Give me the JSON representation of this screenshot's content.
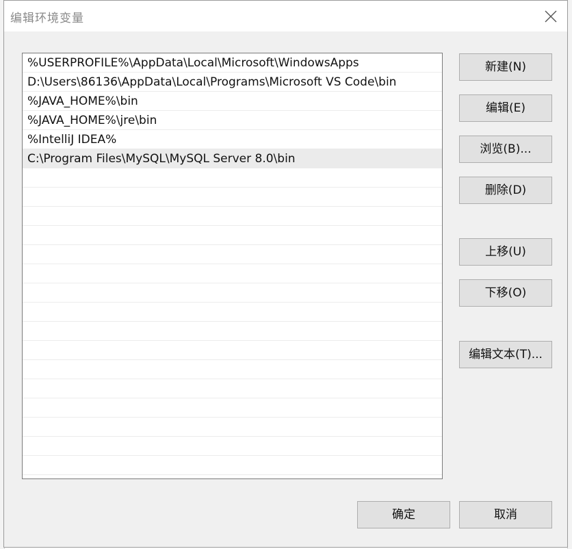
{
  "dialog": {
    "title": "编辑环境变量"
  },
  "icons": {
    "close": "close-icon"
  },
  "path_list": [
    "%USERPROFILE%\\AppData\\Local\\Microsoft\\WindowsApps",
    "D:\\Users\\86136\\AppData\\Local\\Programs\\Microsoft VS Code\\bin",
    "%JAVA_HOME%\\bin",
    "%JAVA_HOME%\\jre\\bin",
    "%IntelliJ IDEA%",
    "C:\\Program Files\\MySQL\\MySQL Server 8.0\\bin",
    "",
    "",
    "",
    "",
    "",
    "",
    "",
    "",
    "",
    "",
    "",
    "",
    "",
    "",
    "",
    ""
  ],
  "selected_index": 5,
  "buttons": {
    "new": "新建(N)",
    "edit": "编辑(E)",
    "browse": "浏览(B)...",
    "delete": "删除(D)",
    "move_up": "上移(U)",
    "move_down": "下移(O)",
    "edit_text": "编辑文本(T)...",
    "ok": "确定",
    "cancel": "取消"
  }
}
